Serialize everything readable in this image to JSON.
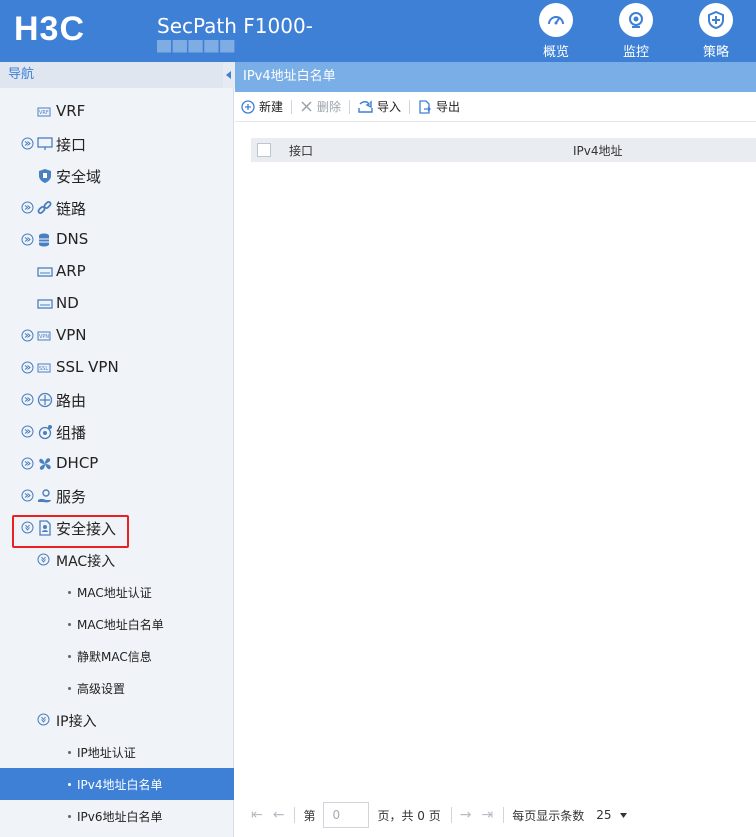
{
  "header": {
    "product": "SecPath F1000-",
    "nav": [
      {
        "label": "概览",
        "icon": "speedometer-icon"
      },
      {
        "label": "监控",
        "icon": "camera-icon"
      },
      {
        "label": "策略",
        "icon": "shield-icon"
      }
    ],
    "logo_text": "H3C"
  },
  "sidebar": {
    "title": "导航",
    "items": [
      {
        "label": "VRF"
      },
      {
        "label": "接口"
      },
      {
        "label": "安全域"
      },
      {
        "label": "链路"
      },
      {
        "label": "DNS"
      },
      {
        "label": "ARP"
      },
      {
        "label": "ND"
      },
      {
        "label": "VPN"
      },
      {
        "label": "SSL VPN"
      },
      {
        "label": "路由"
      },
      {
        "label": "组播"
      },
      {
        "label": "DHCP"
      },
      {
        "label": "服务"
      },
      {
        "label": "安全接入"
      },
      {
        "label": "MAC接入"
      },
      {
        "label": "MAC地址认证"
      },
      {
        "label": "MAC地址白名单"
      },
      {
        "label": "静默MAC信息"
      },
      {
        "label": "高级设置"
      },
      {
        "label": "IP接入"
      },
      {
        "label": "IP地址认证"
      },
      {
        "label": "IPv4地址白名单"
      },
      {
        "label": "IPv6地址白名单"
      }
    ]
  },
  "main": {
    "title": "IPv4地址白名单",
    "toolbar": {
      "new_label": "新建",
      "delete_label": "删除",
      "import_label": "导入",
      "export_label": "导出"
    },
    "table": {
      "columns": [
        "接口",
        "IPv4地址"
      ]
    },
    "pager": {
      "page_prefix": "第",
      "page_value": "0",
      "page_suffix": "页，共 0 页",
      "per_page_label": "每页显示条数",
      "per_page_value": "25"
    }
  },
  "colors": {
    "header_bg": "#3d80d6",
    "active_item": "#3d80d6",
    "title_bar": "#79aee6",
    "highlight": "#e62222"
  }
}
